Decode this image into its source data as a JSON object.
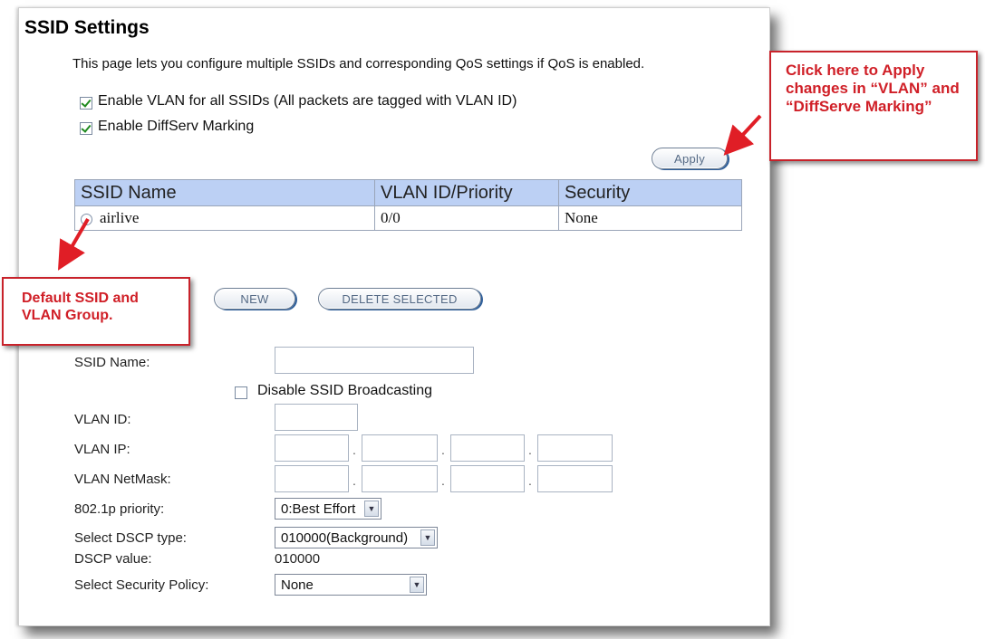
{
  "page": {
    "title": "SSID Settings",
    "description": "This page lets you configure multiple SSIDs and corresponding QoS settings if QoS is enabled."
  },
  "options": {
    "enable_vlan_label": "Enable VLAN for all SSIDs (All packets are tagged with VLAN ID)",
    "enable_vlan_checked": true,
    "enable_diffserv_label": "Enable DiffServ Marking",
    "enable_diffserv_checked": true,
    "apply_label": "Apply"
  },
  "ssid_table": {
    "headers": [
      "SSID Name",
      "VLAN ID/Priority",
      "Security"
    ],
    "rows": [
      {
        "name": "airlive",
        "vlan_priority": "0/0",
        "security": "None"
      }
    ]
  },
  "actions": {
    "new_label": "NEW",
    "delete_label": "DELETE SELECTED"
  },
  "form": {
    "ssid_name_label": "SSID Name:",
    "ssid_name_value": "",
    "disable_broadcast_label": "Disable SSID Broadcasting",
    "disable_broadcast_checked": false,
    "vlan_id_label": "VLAN ID:",
    "vlan_id_value": "",
    "vlan_ip_label": "VLAN IP:",
    "vlan_ip_octets": [
      "",
      "",
      "",
      ""
    ],
    "vlan_netmask_label": "VLAN NetMask:",
    "vlan_netmask_octets": [
      "",
      "",
      "",
      ""
    ],
    "priority_label": "802.1p priority:",
    "priority_value": "0:Best Effort",
    "dscp_type_label": "Select DSCP type:",
    "dscp_type_value": "010000(Background)",
    "dscp_value_label": "DSCP value:",
    "dscp_value": "010000",
    "security_policy_label": "Select Security Policy:",
    "security_policy_value": "None"
  },
  "annotations": {
    "apply_note": "Click here to Apply changes in “VLAN” and “DiffServe Marking”",
    "default_note": "Default SSID and VLAN Group."
  },
  "colors": {
    "table_header_bg": "#bcd0f4",
    "callout_red": "#d01f27"
  }
}
